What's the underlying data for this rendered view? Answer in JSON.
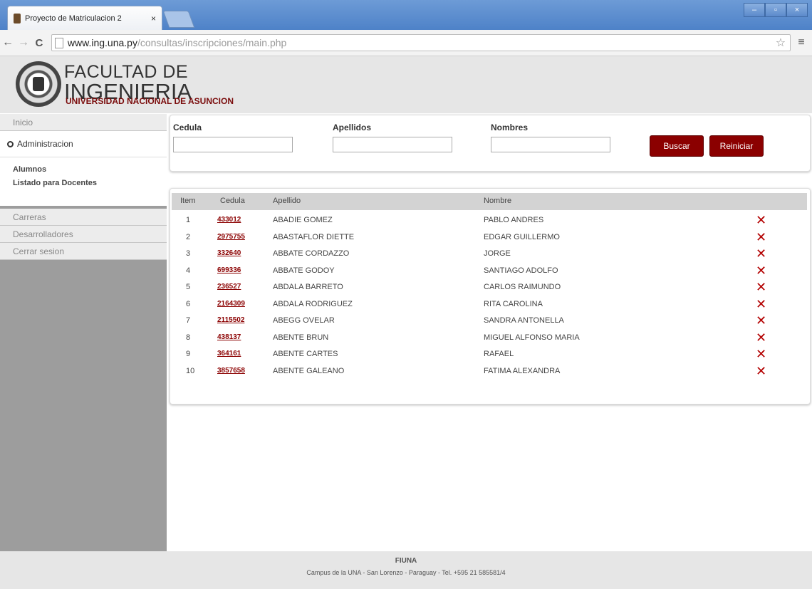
{
  "browser": {
    "tab_title": "Proyecto de Matriculacion 2",
    "tab_close": "×",
    "url_host": "www.ing.una.py",
    "url_path": "/consultas/inscripciones/main.php",
    "back": "←",
    "forward": "→",
    "reload": "C",
    "star": "☆",
    "menu": "≡",
    "minimize": "–",
    "maximize": "▫",
    "close": "×"
  },
  "header": {
    "line1": "FACULTAD DE",
    "line2": "INGENIERIA",
    "line3": "UNIVERSIDAD NACIONAL DE ASUNCION"
  },
  "sidebar": {
    "inicio": "Inicio",
    "administracion": "Administracion",
    "sub_alumnos": "Alumnos",
    "sub_docentes": "Listado para Docentes",
    "carreras": "Carreras",
    "desarrolladores": "Desarrolladores",
    "cerrar": "Cerrar sesion"
  },
  "search": {
    "cedula_label": "Cedula",
    "apellidos_label": "Apellidos",
    "nombres_label": "Nombres",
    "buscar": "Buscar",
    "reiniciar": "Reiniciar"
  },
  "table": {
    "headers": {
      "item": "Item",
      "cedula": "Cedula",
      "apellido": "Apellido",
      "nombre": "Nombre"
    },
    "rows": [
      {
        "item": "1",
        "cedula": "433012",
        "apellido": "ABADIE GOMEZ",
        "nombre": "PABLO ANDRES"
      },
      {
        "item": "2",
        "cedula": "2975755",
        "apellido": "ABASTAFLOR DIETTE",
        "nombre": "EDGAR GUILLERMO"
      },
      {
        "item": "3",
        "cedula": "332640",
        "apellido": "ABBATE CORDAZZO",
        "nombre": "JORGE"
      },
      {
        "item": "4",
        "cedula": "699336",
        "apellido": "ABBATE GODOY",
        "nombre": "SANTIAGO ADOLFO"
      },
      {
        "item": "5",
        "cedula": "236527",
        "apellido": "ABDALA BARRETO",
        "nombre": "CARLOS RAIMUNDO"
      },
      {
        "item": "6",
        "cedula": "2164309",
        "apellido": "ABDALA RODRIGUEZ",
        "nombre": "RITA CAROLINA"
      },
      {
        "item": "7",
        "cedula": "2115502",
        "apellido": "ABEGG OVELAR",
        "nombre": "SANDRA ANTONELLA"
      },
      {
        "item": "8",
        "cedula": "438137",
        "apellido": "ABENTE BRUN",
        "nombre": "MIGUEL ALFONSO MARIA"
      },
      {
        "item": "9",
        "cedula": "364161",
        "apellido": "ABENTE CARTES",
        "nombre": "RAFAEL"
      },
      {
        "item": "10",
        "cedula": "3857658",
        "apellido": "ABENTE GALEANO",
        "nombre": "FATIMA ALEXANDRA"
      }
    ],
    "delete_glyph": "✕"
  },
  "footer": {
    "line1": "FIUNA",
    "line2": "Campus de la UNA - San Lorenzo - Paraguay - Tel. +595 21 585581/4"
  },
  "colors": {
    "accent": "#8b0000",
    "sidebar": "#9d9d9d",
    "header": "#e6e6e6"
  }
}
